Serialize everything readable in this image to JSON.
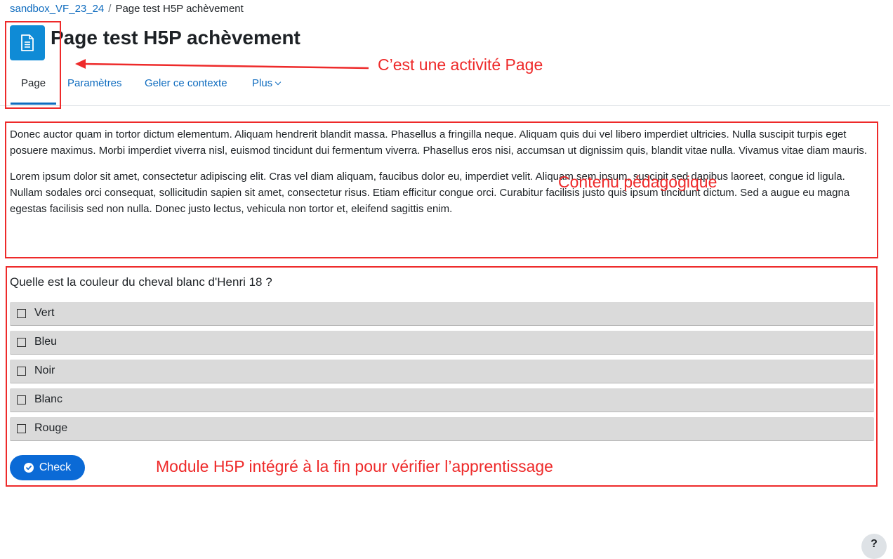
{
  "breadcrumb": {
    "course": "sandbox_VF_23_24",
    "separator": "/",
    "current": "Page test H5P achèvement"
  },
  "header": {
    "title": "Page test H5P achèvement",
    "icon": "page-document-icon",
    "icon_color": "#0f8bd6"
  },
  "tabs": {
    "page": "Page",
    "settings": "Paramètres",
    "freeze": "Geler ce contexte",
    "more": "Plus"
  },
  "content": {
    "paragraph1": "Donec auctor quam in tortor dictum elementum. Aliquam hendrerit blandit massa. Phasellus a fringilla neque. Aliquam quis dui vel libero imperdiet ultricies. Nulla suscipit turpis eget posuere maximus. Morbi imperdiet viverra nisl, euismod tincidunt dui fermentum viverra. Phasellus eros nisi, accumsan ut dignissim quis, blandit vitae nulla. Vivamus vitae diam mauris.",
    "paragraph2": "Lorem ipsum dolor sit amet, consectetur adipiscing elit. Cras vel diam aliquam, faucibus dolor eu, imperdiet velit. Aliquam sem ipsum, suscipit sed dapibus laoreet, congue id ligula. Nullam sodales orci consequat, sollicitudin sapien sit amet, consectetur risus. Etiam efficitur congue orci. Curabitur facilisis justo quis ipsum tincidunt dictum. Sed a augue eu magna egestas facilisis sed non nulla. Donec justo lectus, vehicula non tortor et, eleifend sagittis enim."
  },
  "h5p": {
    "question": "Quelle est la couleur du cheval blanc d'Henri 18 ?",
    "options": [
      "Vert",
      "Bleu",
      "Noir",
      "Blanc",
      "Rouge"
    ],
    "check_label": "Check",
    "check_color": "#0b6ad6"
  },
  "annotations": {
    "activity_label": "C’est une activité Page",
    "content_label": "Contenu pédagogique",
    "module_label": "Module H5P intégré à la fin pour vérifier l’apprentissage",
    "color": "#ee2a2a"
  },
  "help": {
    "label": "?"
  }
}
